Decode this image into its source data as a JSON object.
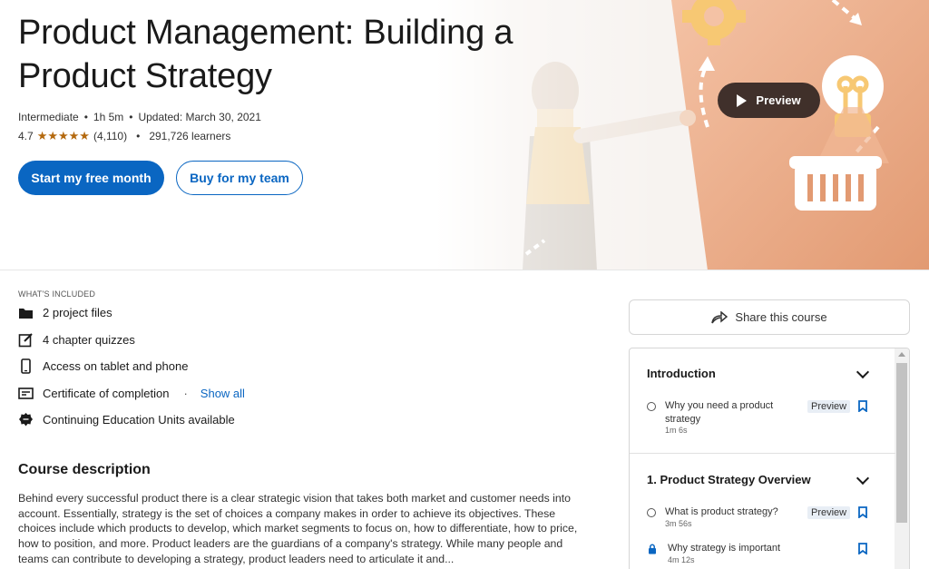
{
  "course": {
    "title": "Product Management: Building a Product Strategy",
    "level": "Intermediate",
    "duration": "1h 5m",
    "updated": "Updated: March 30, 2021",
    "rating": "4.7",
    "stars": "★★★★★",
    "rating_count": "(4,110)",
    "learners": "291,726 learners",
    "separator": "•"
  },
  "hero": {
    "primary_button": "Start my free month",
    "secondary_button": "Buy for my team",
    "preview_label": "Preview"
  },
  "included": {
    "label": "WHAT'S INCLUDED",
    "items": [
      {
        "icon": "folder-icon",
        "label": "2 project files"
      },
      {
        "icon": "quiz-edit-icon",
        "label": "4 chapter quizzes"
      },
      {
        "icon": "phone-icon",
        "label": "Access on tablet and phone"
      },
      {
        "icon": "certificate-icon",
        "label": "Certificate of completion"
      },
      {
        "icon": "badge-icon",
        "label": "Continuing Education Units available"
      }
    ],
    "show_all": "Show all",
    "show_all_sep": "·"
  },
  "description": {
    "title": "Course description",
    "body": "Behind every successful product there is a clear strategic vision that takes both market and customer needs into account. Essentially, strategy is the set of choices a company makes in order to achieve its objectives. These choices include which products to develop, which market segments to focus on, how to differentiate, how to price, how to position, and more. Product leaders are the guardians of a company's strategy. While many people and teams can contribute to developing a strategy, product leaders need to articulate it and..."
  },
  "sidebar": {
    "share_label": "Share this course",
    "sections": [
      {
        "title": "Introduction",
        "lessons": [
          {
            "title": "Why you need a product strategy",
            "duration": "1m 6s",
            "badge": "Preview",
            "locked": false
          }
        ]
      },
      {
        "title": "1. Product Strategy Overview",
        "lessons": [
          {
            "title": "What is product strategy?",
            "duration": "3m 56s",
            "badge": "Preview",
            "locked": false
          },
          {
            "title": "Why strategy is important",
            "duration": "4m 12s",
            "badge": "",
            "locked": true
          }
        ]
      }
    ]
  },
  "colors": {
    "brand": "#0a66c2",
    "star": "#b4690e",
    "art_peach": "#e9a57e"
  }
}
